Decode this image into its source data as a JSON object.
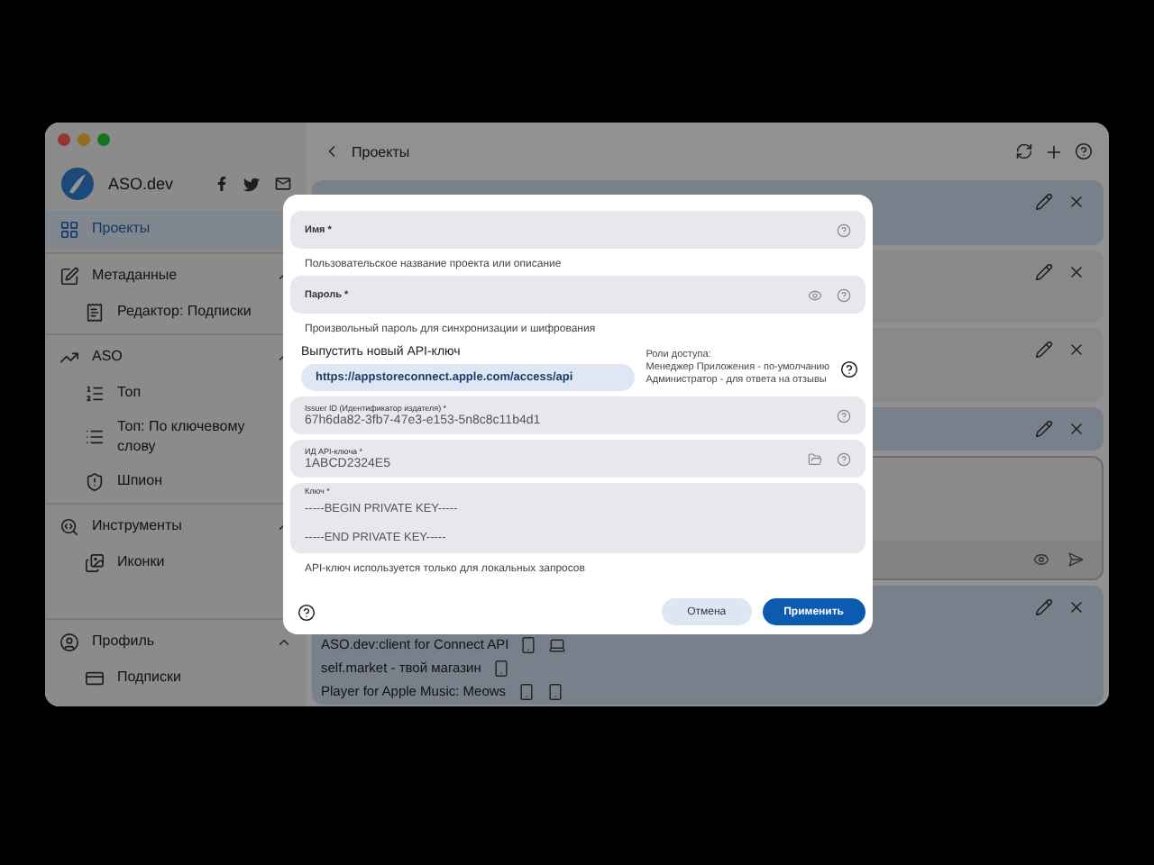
{
  "sidebar": {
    "brand": "ASO.dev",
    "items": [
      {
        "kind": "link",
        "label": "Проекты",
        "selected": true
      },
      {
        "kind": "group",
        "label": "Метаданные",
        "expanded": true,
        "children": [
          {
            "label": "Редактор: Подписки",
            "selected": false
          }
        ]
      },
      {
        "kind": "group",
        "label": "ASO",
        "expanded": true,
        "children": [
          {
            "label": "Топ",
            "selected": false
          },
          {
            "label": "Топ: По ключевому слову",
            "selected": false
          },
          {
            "label": "Шпион",
            "selected": false
          }
        ]
      },
      {
        "kind": "group",
        "label": "Инструменты",
        "expanded": true,
        "children": [
          {
            "label": "Иконки",
            "selected": false
          }
        ]
      }
    ],
    "footer_group": {
      "label": "Профиль",
      "expanded": true,
      "children": [
        {
          "label": "Подписки",
          "selected": false
        }
      ]
    }
  },
  "header": {
    "title": "Проекты"
  },
  "cards": [
    {
      "kind": "project",
      "highlighted": true
    },
    {
      "kind": "project",
      "highlighted": false
    },
    {
      "kind": "project",
      "highlighted": false
    },
    {
      "kind": "project",
      "highlighted": true
    },
    {
      "kind": "editor",
      "highlighted": false
    },
    {
      "kind": "project",
      "highlighted": true,
      "apps": [
        {
          "name": "ASO.dev:client for Connect API",
          "devices": [
            {
              "kind": "phone"
            },
            {
              "kind": "laptop"
            }
          ]
        },
        {
          "name": "self.market - твой магазин",
          "devices": [
            {
              "kind": "phone"
            }
          ]
        },
        {
          "name": "Player for Apple Music: Meows",
          "devices": [
            {
              "kind": "phone"
            },
            {
              "kind": "phone"
            }
          ]
        }
      ]
    }
  ],
  "dialog": {
    "fields": [
      {
        "kind": "text",
        "label": "Имя *",
        "helper": "Пользовательское название проекта или описание"
      },
      {
        "kind": "password",
        "label": "Пароль *",
        "helper": "Произвольный пароль для синхронизации и шифрования"
      },
      {
        "kind": "apikey"
      },
      {
        "kind": "text",
        "label": "Issuer ID (Идентификатор издателя) *",
        "value": "67h6da82-3fb7-47e3-e153-5n8c8c11b4d1"
      },
      {
        "kind": "file",
        "label": "ИД API-ключа *",
        "value": "1ABCD2324E5"
      },
      {
        "kind": "textarea",
        "label": "Ключ *",
        "lines": [
          "-----BEGIN PRIVATE KEY-----",
          "-----END PRIVATE KEY-----"
        ],
        "helper": "API-ключ используется только для локальных запросов"
      }
    ],
    "api_key": {
      "title": "Выпустить новый API-ключ",
      "link": "https://appstoreconnect.apple.com/access/api",
      "roles": [
        "Роли доступа:",
        "Менеджер Приложения - по-умолчанию",
        "Администратор - для ответа на отзывы"
      ]
    },
    "buttons": [
      {
        "kind": "secondary",
        "label": "Отмена"
      },
      {
        "kind": "primary",
        "label": "Применить"
      }
    ]
  }
}
